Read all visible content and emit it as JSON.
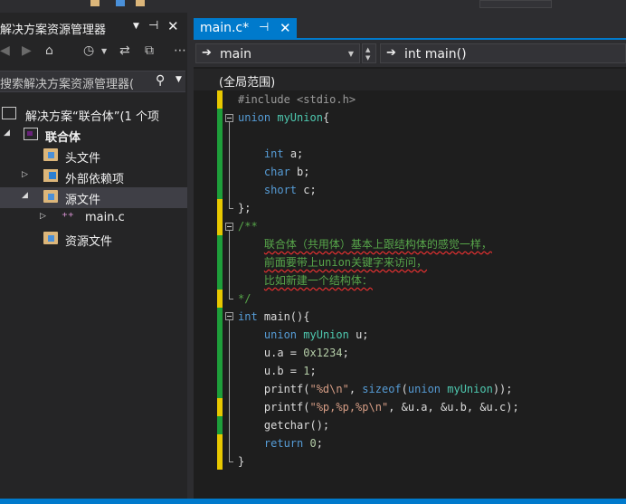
{
  "solution_explorer": {
    "title": "解决方案资源管理器",
    "search_placeholder": "搜索解决方案资源管理器(",
    "tree": [
      {
        "label": "解决方案“联合体”(1 个项",
        "level": 0,
        "icon": "solution-icon",
        "expander": "none"
      },
      {
        "label": "联合体",
        "level": 1,
        "icon": "project-icon",
        "expander": "expanded",
        "bold": true
      },
      {
        "label": "头文件",
        "level": 2,
        "icon": "folder-icon",
        "expander": "none"
      },
      {
        "label": "外部依赖项",
        "level": 2,
        "icon": "dependencies-icon",
        "expander": "collapsed"
      },
      {
        "label": "源文件",
        "level": 2,
        "icon": "folder-icon",
        "expander": "expanded",
        "selected": true
      },
      {
        "label": "main.c",
        "level": 3,
        "icon": "c-file-icon",
        "expander": "collapsed"
      },
      {
        "label": "资源文件",
        "level": 2,
        "icon": "folder-icon",
        "expander": "none"
      }
    ]
  },
  "editor": {
    "tab": {
      "label": "main.c*",
      "pin_glyph": "⊣",
      "close_glyph": "✕"
    },
    "nav_left": {
      "label": "main"
    },
    "nav_right": {
      "label": "int main()"
    },
    "scope": "(全局范围)",
    "lines": [
      {
        "tokens": [
          {
            "t": "#include <stdio.h>",
            "c": "pp"
          }
        ]
      },
      {
        "tokens": [
          {
            "t": "union",
            "c": "kw"
          },
          {
            "t": " ",
            "c": "tx"
          },
          {
            "t": "myUnion",
            "c": "ty"
          },
          {
            "t": "{",
            "c": "tx"
          }
        ]
      },
      {
        "tokens": []
      },
      {
        "tokens": [
          {
            "t": "    ",
            "c": "tx"
          },
          {
            "t": "int",
            "c": "kw"
          },
          {
            "t": " a;",
            "c": "tx"
          }
        ]
      },
      {
        "tokens": [
          {
            "t": "    ",
            "c": "tx"
          },
          {
            "t": "char",
            "c": "kw"
          },
          {
            "t": " b;",
            "c": "tx"
          }
        ]
      },
      {
        "tokens": [
          {
            "t": "    ",
            "c": "tx"
          },
          {
            "t": "short",
            "c": "kw"
          },
          {
            "t": " c;",
            "c": "tx"
          }
        ]
      },
      {
        "tokens": [
          {
            "t": "};",
            "c": "tx"
          }
        ]
      },
      {
        "tokens": [
          {
            "t": "/**",
            "c": "cm"
          }
        ]
      },
      {
        "tokens": [
          {
            "t": "    ",
            "c": "cm"
          },
          {
            "t": "联合体（共用体）基本上跟结构体的感觉一样，",
            "c": "cm",
            "squig": true
          }
        ]
      },
      {
        "tokens": [
          {
            "t": "    ",
            "c": "cm"
          },
          {
            "t": "前面要带上union关键字来访问，",
            "c": "cm",
            "squig": true
          }
        ]
      },
      {
        "tokens": [
          {
            "t": "    ",
            "c": "cm"
          },
          {
            "t": "比如新建一个结构体：",
            "c": "cm",
            "squig": true
          }
        ]
      },
      {
        "tokens": [
          {
            "t": "*/",
            "c": "cm"
          }
        ]
      },
      {
        "tokens": [
          {
            "t": "int",
            "c": "kw"
          },
          {
            "t": " main(){",
            "c": "tx"
          }
        ]
      },
      {
        "tokens": [
          {
            "t": "    ",
            "c": "tx"
          },
          {
            "t": "union",
            "c": "kw"
          },
          {
            "t": " ",
            "c": "tx"
          },
          {
            "t": "myUnion",
            "c": "ty"
          },
          {
            "t": " u;",
            "c": "tx"
          }
        ]
      },
      {
        "tokens": [
          {
            "t": "    u.a = ",
            "c": "tx"
          },
          {
            "t": "0x1234",
            "c": "num"
          },
          {
            "t": ";",
            "c": "tx"
          }
        ]
      },
      {
        "tokens": [
          {
            "t": "    u.b = ",
            "c": "tx"
          },
          {
            "t": "1",
            "c": "num"
          },
          {
            "t": ";",
            "c": "tx"
          }
        ]
      },
      {
        "tokens": [
          {
            "t": "    printf(",
            "c": "tx"
          },
          {
            "t": "\"%d\\n\"",
            "c": "str"
          },
          {
            "t": ", ",
            "c": "tx"
          },
          {
            "t": "sizeof",
            "c": "kw"
          },
          {
            "t": "(",
            "c": "tx"
          },
          {
            "t": "union",
            "c": "kw"
          },
          {
            "t": " ",
            "c": "tx"
          },
          {
            "t": "myUnion",
            "c": "ty"
          },
          {
            "t": "));",
            "c": "tx"
          }
        ]
      },
      {
        "tokens": [
          {
            "t": "    printf(",
            "c": "tx"
          },
          {
            "t": "\"%p,%p,%p\\n\"",
            "c": "str"
          },
          {
            "t": ", &u.a, &u.b, &u.c);",
            "c": "tx"
          }
        ]
      },
      {
        "tokens": [
          {
            "t": "    getchar();",
            "c": "tx"
          }
        ]
      },
      {
        "tokens": [
          {
            "t": "    ",
            "c": "tx"
          },
          {
            "t": "return",
            "c": "kw"
          },
          {
            "t": " ",
            "c": "tx"
          },
          {
            "t": "0",
            "c": "num"
          },
          {
            "t": ";",
            "c": "tx"
          }
        ]
      },
      {
        "tokens": [
          {
            "t": "}",
            "c": "tx"
          }
        ]
      }
    ]
  },
  "colors": {
    "accent": "#007acc",
    "change_saved": "#1e9e3a",
    "change_unsaved": "#e8c800"
  }
}
